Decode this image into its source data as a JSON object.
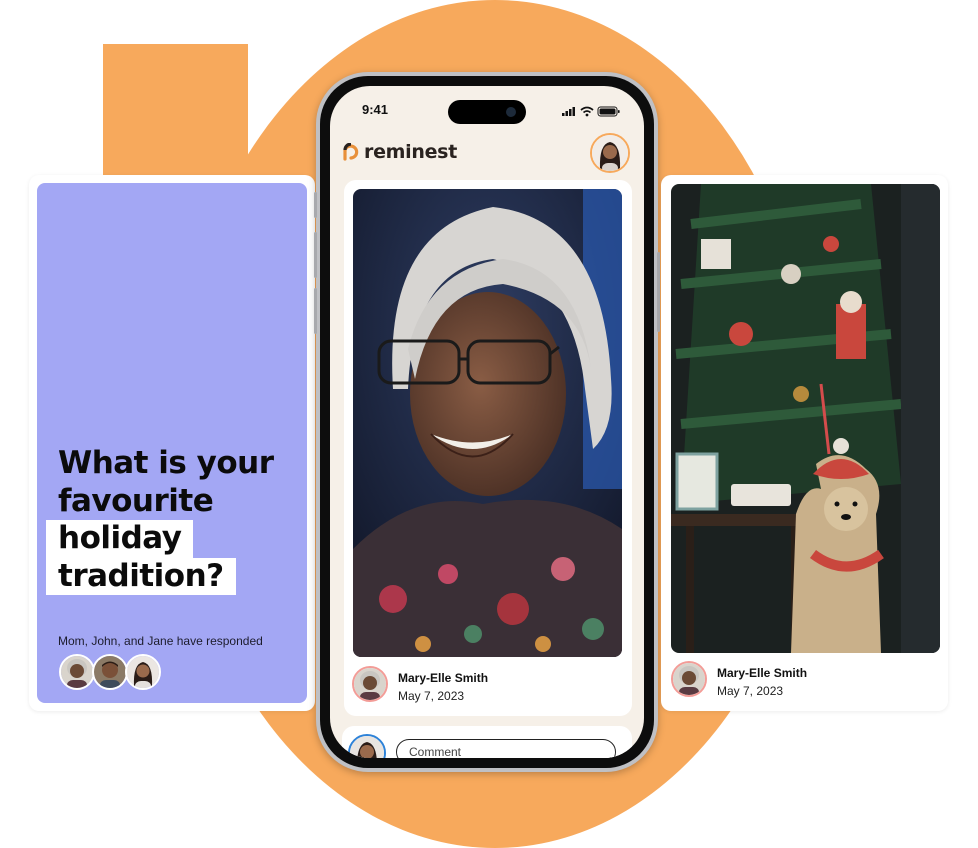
{
  "prompt_card": {
    "question_lines": [
      "What is your",
      "favourite",
      "holiday",
      "tradition?"
    ],
    "responded_text": "Mom, John, and Jane have responded",
    "accent_color": "#A3A7F4"
  },
  "phone": {
    "status_time": "9:41",
    "app_name": "reminest",
    "post": {
      "author": "Mary-Elle Smith",
      "date": "May 7, 2023"
    },
    "comment_placeholder": "Comment"
  },
  "right_card": {
    "author": "Mary-Elle Smith",
    "date": "May 7, 2023"
  },
  "colors": {
    "brand_orange": "#F7A95C",
    "screen_bg": "#F6F0E8",
    "avatar_ring": "#F39C97",
    "comment_avatar_ring": "#2D82D8"
  }
}
